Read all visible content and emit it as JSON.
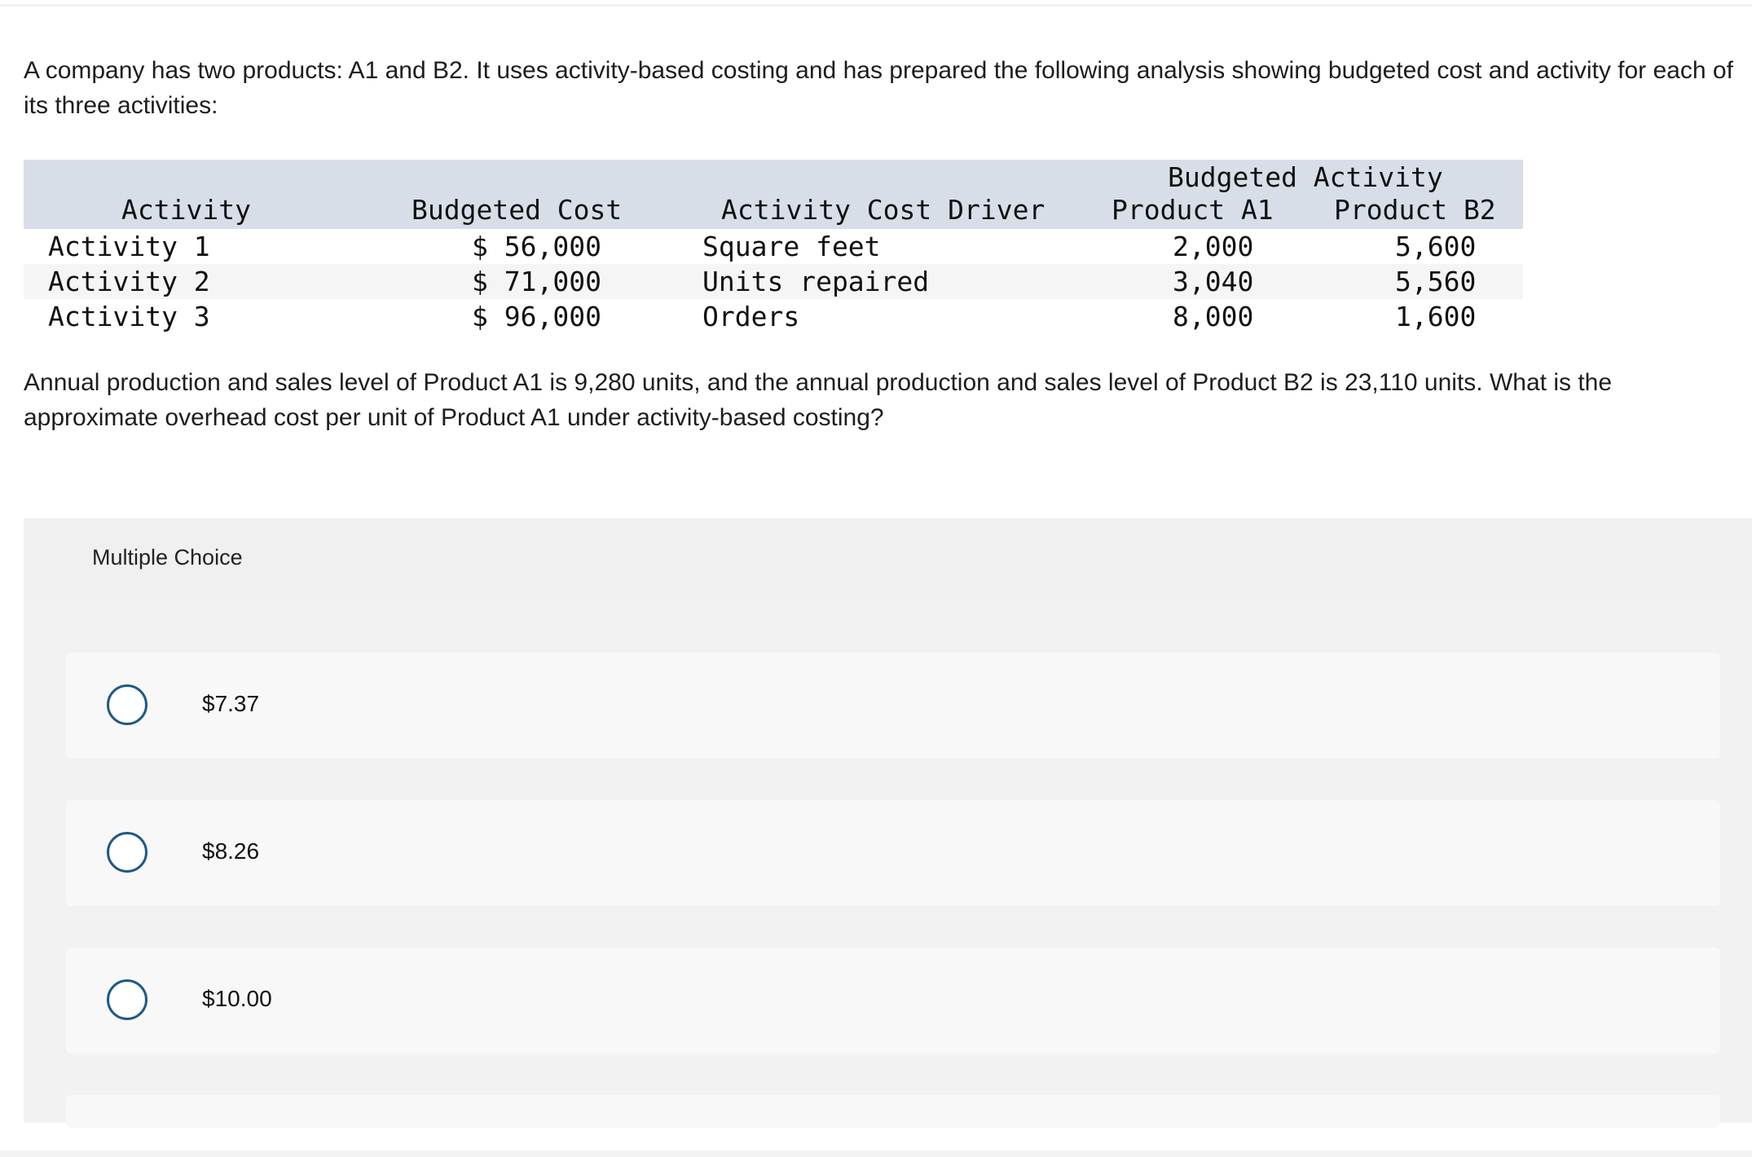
{
  "question": {
    "intro": "A company has two products: A1 and B2. It uses activity-based costing and has prepared the following analysis showing budgeted cost and activity for each of its three activities:",
    "followup": "Annual production and sales level of Product A1 is 9,280 units, and the annual production and sales level of Product B2 is 23,110 units. What is the approximate overhead cost per unit of Product A1 under activity-based costing?"
  },
  "table": {
    "group_header": "Budgeted Activity",
    "headers": {
      "activity": "Activity",
      "budgeted_cost": "Budgeted Cost",
      "driver": "Activity Cost Driver",
      "product_a1": "Product A1",
      "product_b2": "Product B2"
    },
    "rows": [
      {
        "activity": "Activity 1",
        "budgeted_cost": "$ 56,000",
        "driver": "Square feet",
        "product_a1": "2,000",
        "product_b2": "5,600"
      },
      {
        "activity": "Activity 2",
        "budgeted_cost": "$ 71,000",
        "driver": "Units repaired",
        "product_a1": "3,040",
        "product_b2": "5,560"
      },
      {
        "activity": "Activity 3",
        "budgeted_cost": "$ 96,000",
        "driver": "Orders",
        "product_a1": "8,000",
        "product_b2": "1,600"
      }
    ]
  },
  "multiple_choice": {
    "label": "Multiple Choice",
    "options": [
      {
        "label": "$7.37"
      },
      {
        "label": "$8.26"
      },
      {
        "label": "$10.00"
      }
    ]
  },
  "colors": {
    "table_header_bg": "#d8dee8",
    "radio_border": "#1e5a85",
    "panel_bg": "#f2f2f2"
  }
}
